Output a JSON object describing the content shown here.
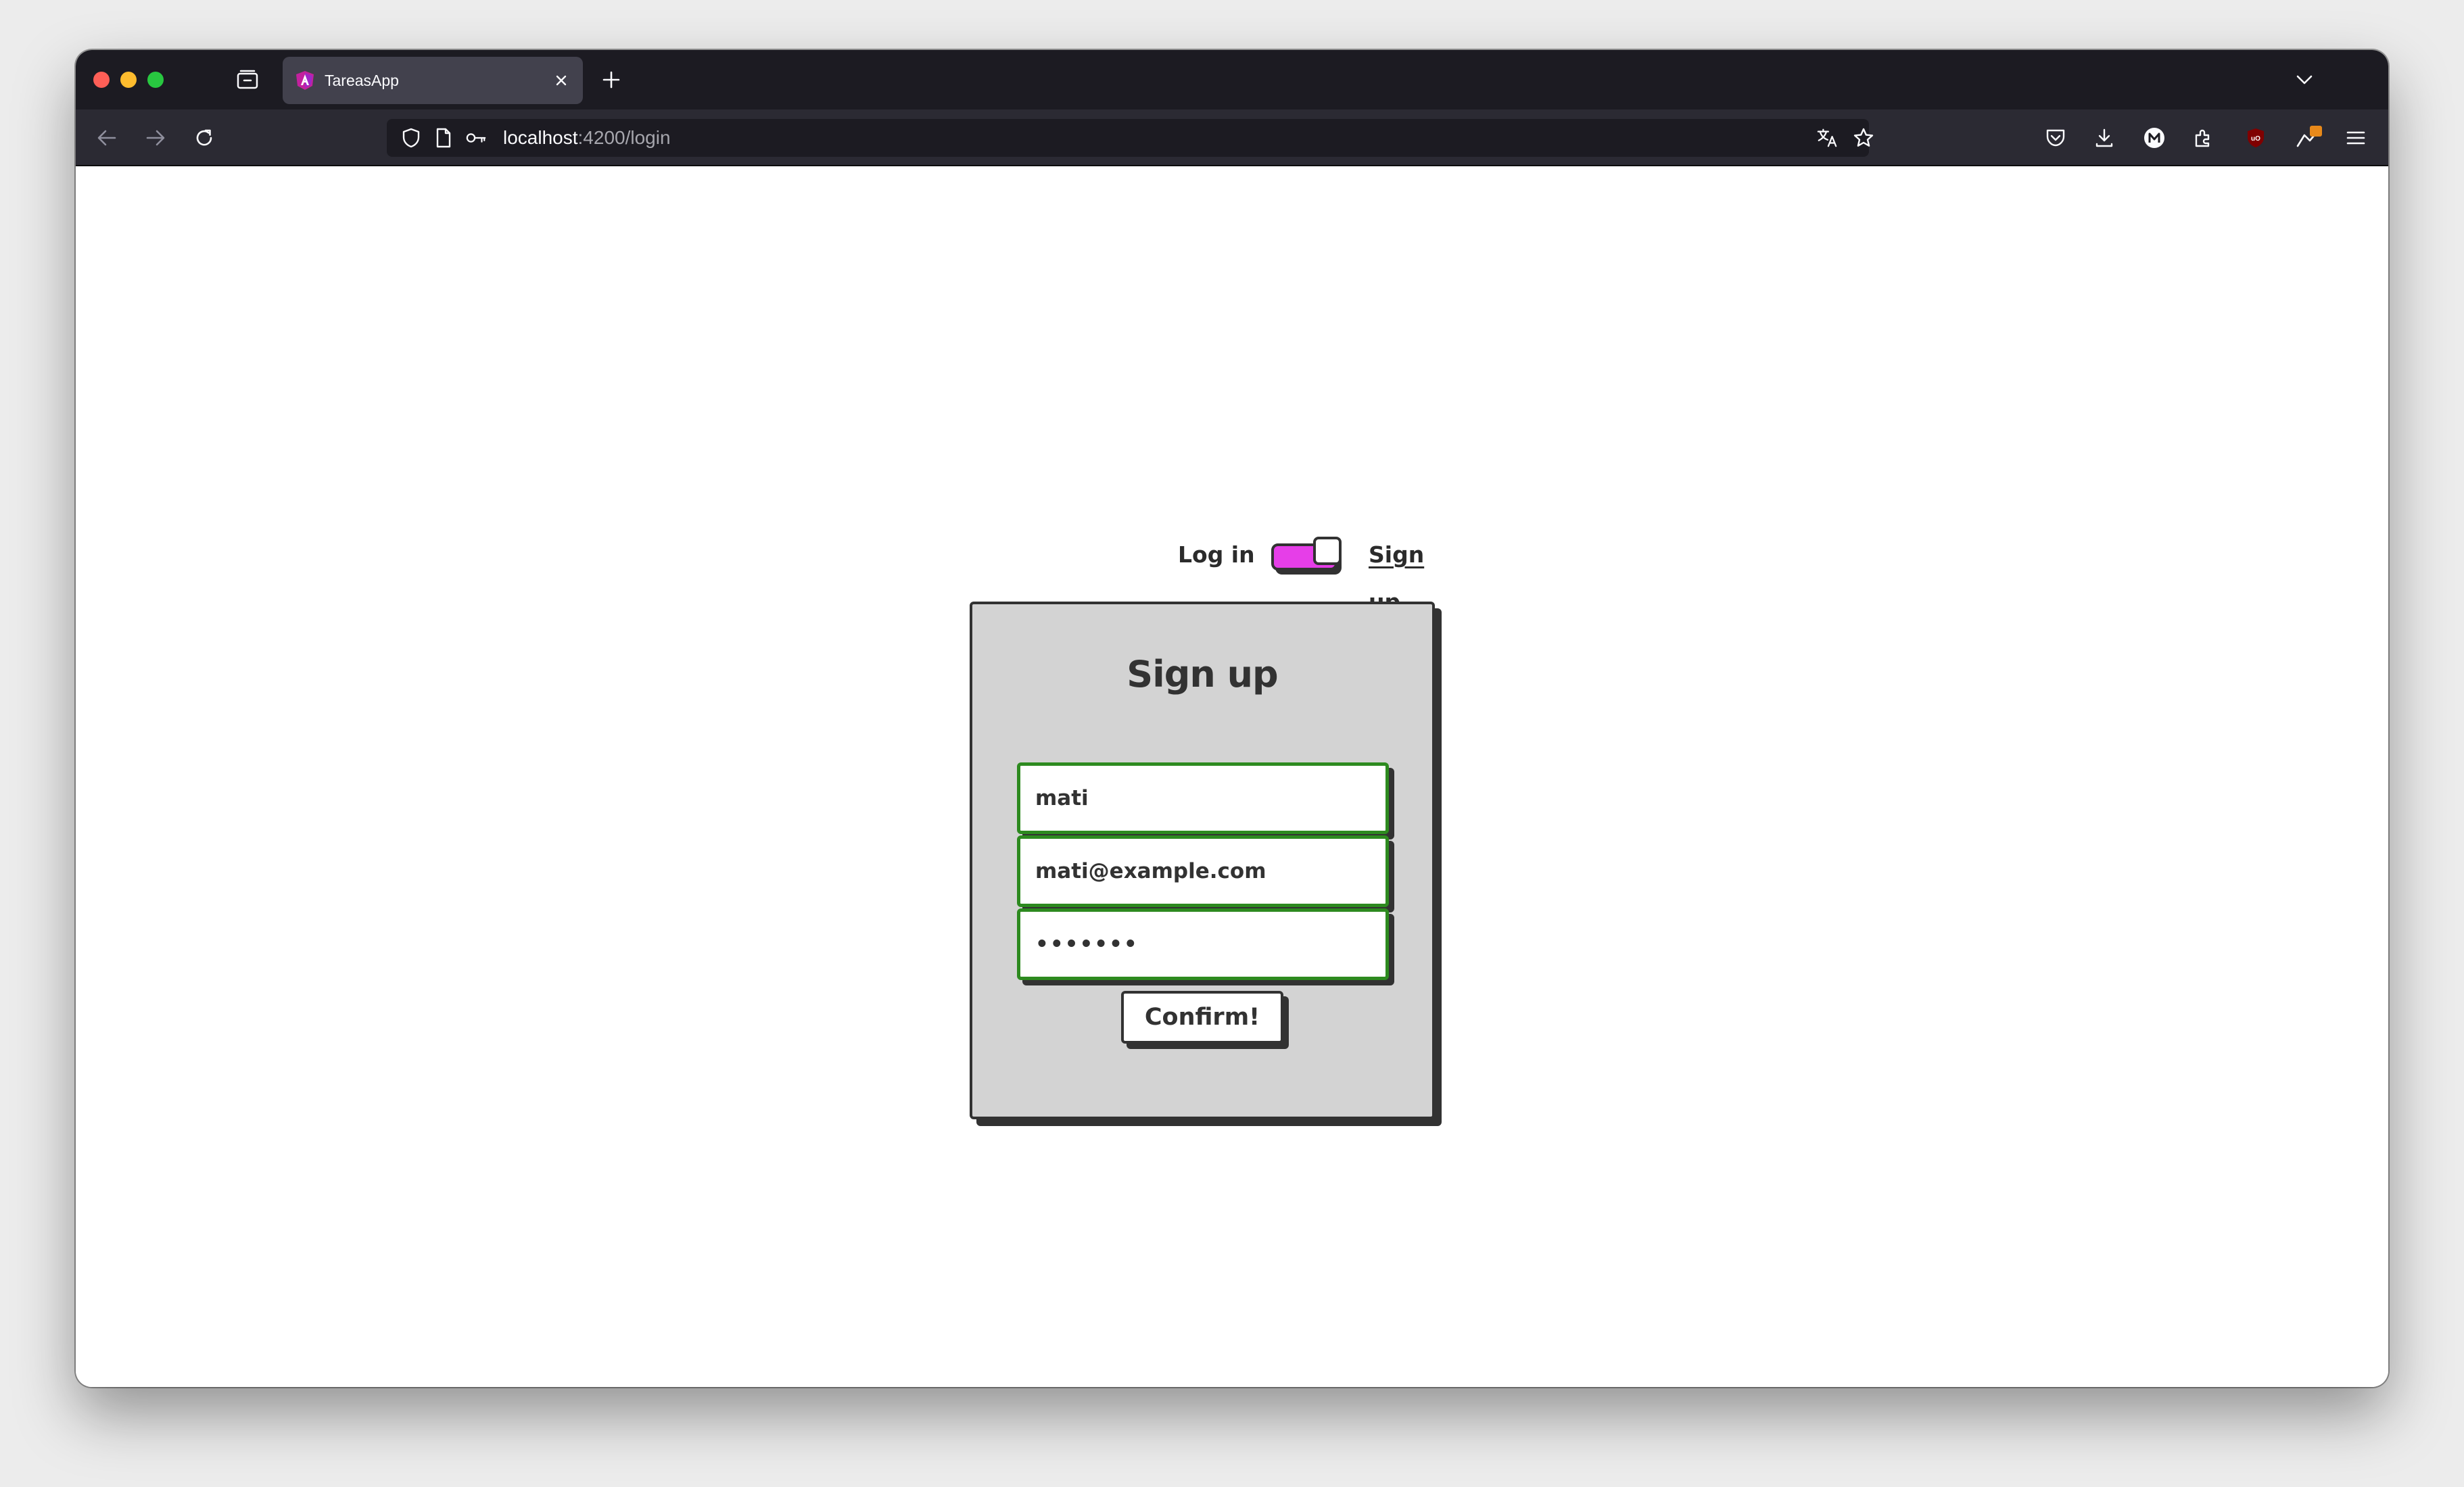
{
  "browser": {
    "tab": {
      "title": "TareasApp"
    },
    "address": {
      "host": "localhost",
      "path": ":4200/login"
    },
    "colors": {
      "tabbar": "#1c1b22",
      "navbar": "#2b2a33",
      "active_tab": "#42414d"
    },
    "extensions": {
      "badge_count": "1"
    }
  },
  "auth": {
    "toggle": {
      "left_label": "Log in",
      "right_label": "Sign up",
      "state": "signup",
      "track_color": "#e63ee8"
    },
    "form": {
      "title": "Sign up",
      "username_value": "mati",
      "email_value": "mati@example.com",
      "password_value": "•••••••",
      "submit_label": "Confirm!",
      "card_color": "#d3d3d3",
      "field_border_color": "#2d8a1f"
    }
  }
}
